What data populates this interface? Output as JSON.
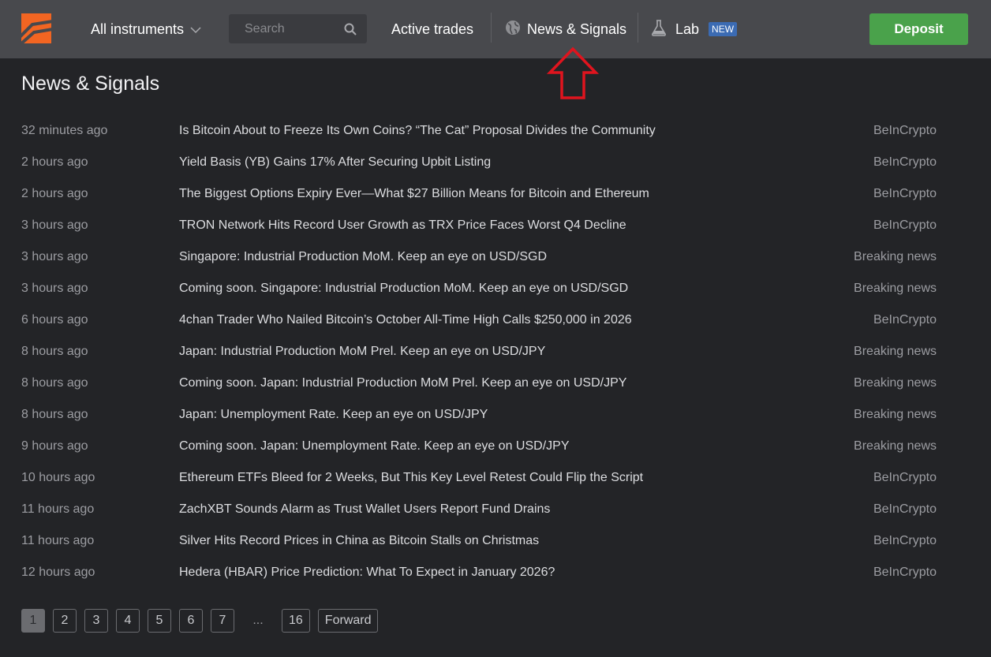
{
  "header": {
    "instruments_label": "All instruments",
    "search_placeholder": "Search",
    "active_trades_label": "Active trades",
    "news_label": "News & Signals",
    "lab_label": "Lab",
    "lab_badge": "NEW",
    "deposit_label": "Deposit"
  },
  "page": {
    "title": "News & Signals"
  },
  "news": [
    {
      "time": "32 minutes ago",
      "title": "Is Bitcoin About to Freeze Its Own Coins? “The Cat” Proposal Divides the Community",
      "source": "BeInCrypto"
    },
    {
      "time": "2 hours ago",
      "title": "Yield Basis (YB) Gains 17% After Securing Upbit Listing",
      "source": "BeInCrypto"
    },
    {
      "time": "2 hours ago",
      "title": "The Biggest Options Expiry Ever—What $27 Billion Means for Bitcoin and Ethereum",
      "source": "BeInCrypto"
    },
    {
      "time": "3 hours ago",
      "title": "TRON Network Hits Record User Growth as TRX Price Faces Worst Q4 Decline",
      "source": "BeInCrypto"
    },
    {
      "time": "3 hours ago",
      "title": "Singapore: Industrial Production MoM. Keep an eye on USD/SGD",
      "source": "Breaking news"
    },
    {
      "time": "3 hours ago",
      "title": "Coming soon. Singapore: Industrial Production MoM. Keep an eye on USD/SGD",
      "source": "Breaking news"
    },
    {
      "time": "6 hours ago",
      "title": "4chan Trader Who Nailed Bitcoin’s October All-Time High Calls $250,000 in 2026",
      "source": "BeInCrypto"
    },
    {
      "time": "8 hours ago",
      "title": "Japan: Industrial Production MoM Prel. Keep an eye on USD/JPY",
      "source": "Breaking news"
    },
    {
      "time": "8 hours ago",
      "title": "Coming soon. Japan: Industrial Production MoM Prel. Keep an eye on USD/JPY",
      "source": "Breaking news"
    },
    {
      "time": "8 hours ago",
      "title": "Japan: Unemployment Rate. Keep an eye on USD/JPY",
      "source": "Breaking news"
    },
    {
      "time": "9 hours ago",
      "title": "Coming soon. Japan: Unemployment Rate. Keep an eye on USD/JPY",
      "source": "Breaking news"
    },
    {
      "time": "10 hours ago",
      "title": "Ethereum ETFs Bleed for 2 Weeks, But This Key Level Retest Could Flip the Script",
      "source": "BeInCrypto"
    },
    {
      "time": "11 hours ago",
      "title": "ZachXBT Sounds Alarm as Trust Wallet Users Report Fund Drains",
      "source": "BeInCrypto"
    },
    {
      "time": "11 hours ago",
      "title": "Silver Hits Record Prices in China as Bitcoin Stalls on Christmas",
      "source": "BeInCrypto"
    },
    {
      "time": "12 hours ago",
      "title": "Hedera (HBAR) Price Prediction: What To Expect in January 2026?",
      "source": "BeInCrypto"
    }
  ],
  "pagination": {
    "pages": [
      "1",
      "2",
      "3",
      "4",
      "5",
      "6",
      "7"
    ],
    "active": "1",
    "ellipsis": "...",
    "last": "16",
    "forward_label": "Forward"
  },
  "colors": {
    "topbar": "#48494d",
    "background": "#232427",
    "deposit": "#4aa24b",
    "badge": "#3b6bb3",
    "logo": "#f26522",
    "annotation": "#e0141e"
  }
}
